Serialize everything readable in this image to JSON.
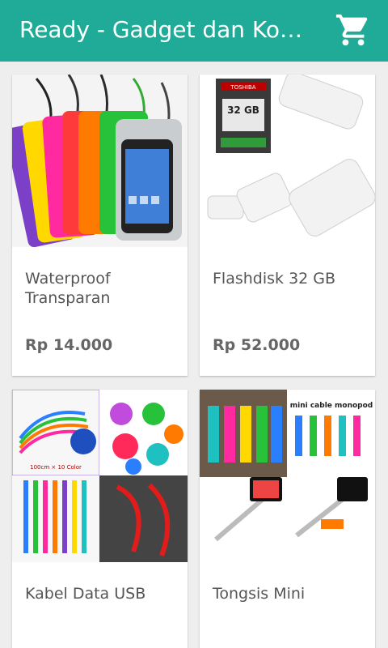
{
  "app": {
    "title": "Ready - Gadget dan Ko…",
    "cart_icon": "shopping-cart-icon",
    "bar_color": "#1fab97"
  },
  "products": [
    {
      "name": "Waterproof Transparan",
      "price": "Rp 14.000"
    },
    {
      "name": "Flashdisk 32 GB",
      "price": "Rp 52.000"
    },
    {
      "name": "Kabel Data USB",
      "price": ""
    },
    {
      "name": "Tongsis Mini",
      "price": ""
    }
  ],
  "image_text": {
    "flashdisk_brand": "TOSHIBA",
    "flashdisk_capacity": "32 GB",
    "cable_caption": "100cm × 10 Color",
    "monopod_caption": "mini cable monopod"
  }
}
